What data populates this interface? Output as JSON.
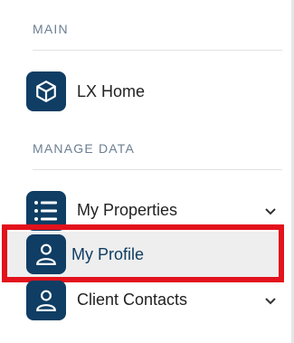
{
  "sections": {
    "main_label": "MAIN",
    "manage_data_label": "MANAGE DATA"
  },
  "nav": {
    "lx_home": {
      "label": "LX Home",
      "icon": "cube-icon"
    },
    "my_properties": {
      "label": "My Properties",
      "icon": "list-icon",
      "expandable": true
    },
    "my_profile": {
      "label": "My Profile",
      "icon": "person-icon",
      "active": true
    },
    "client_contacts": {
      "label": "Client Contacts",
      "icon": "person-icon",
      "expandable": true
    }
  },
  "colors": {
    "icon_tile": "#0f3d63",
    "section_header": "#6b7f92",
    "active_label": "#0f3d63",
    "highlight_box": "#e3121c",
    "active_background": "#eeeeee"
  }
}
